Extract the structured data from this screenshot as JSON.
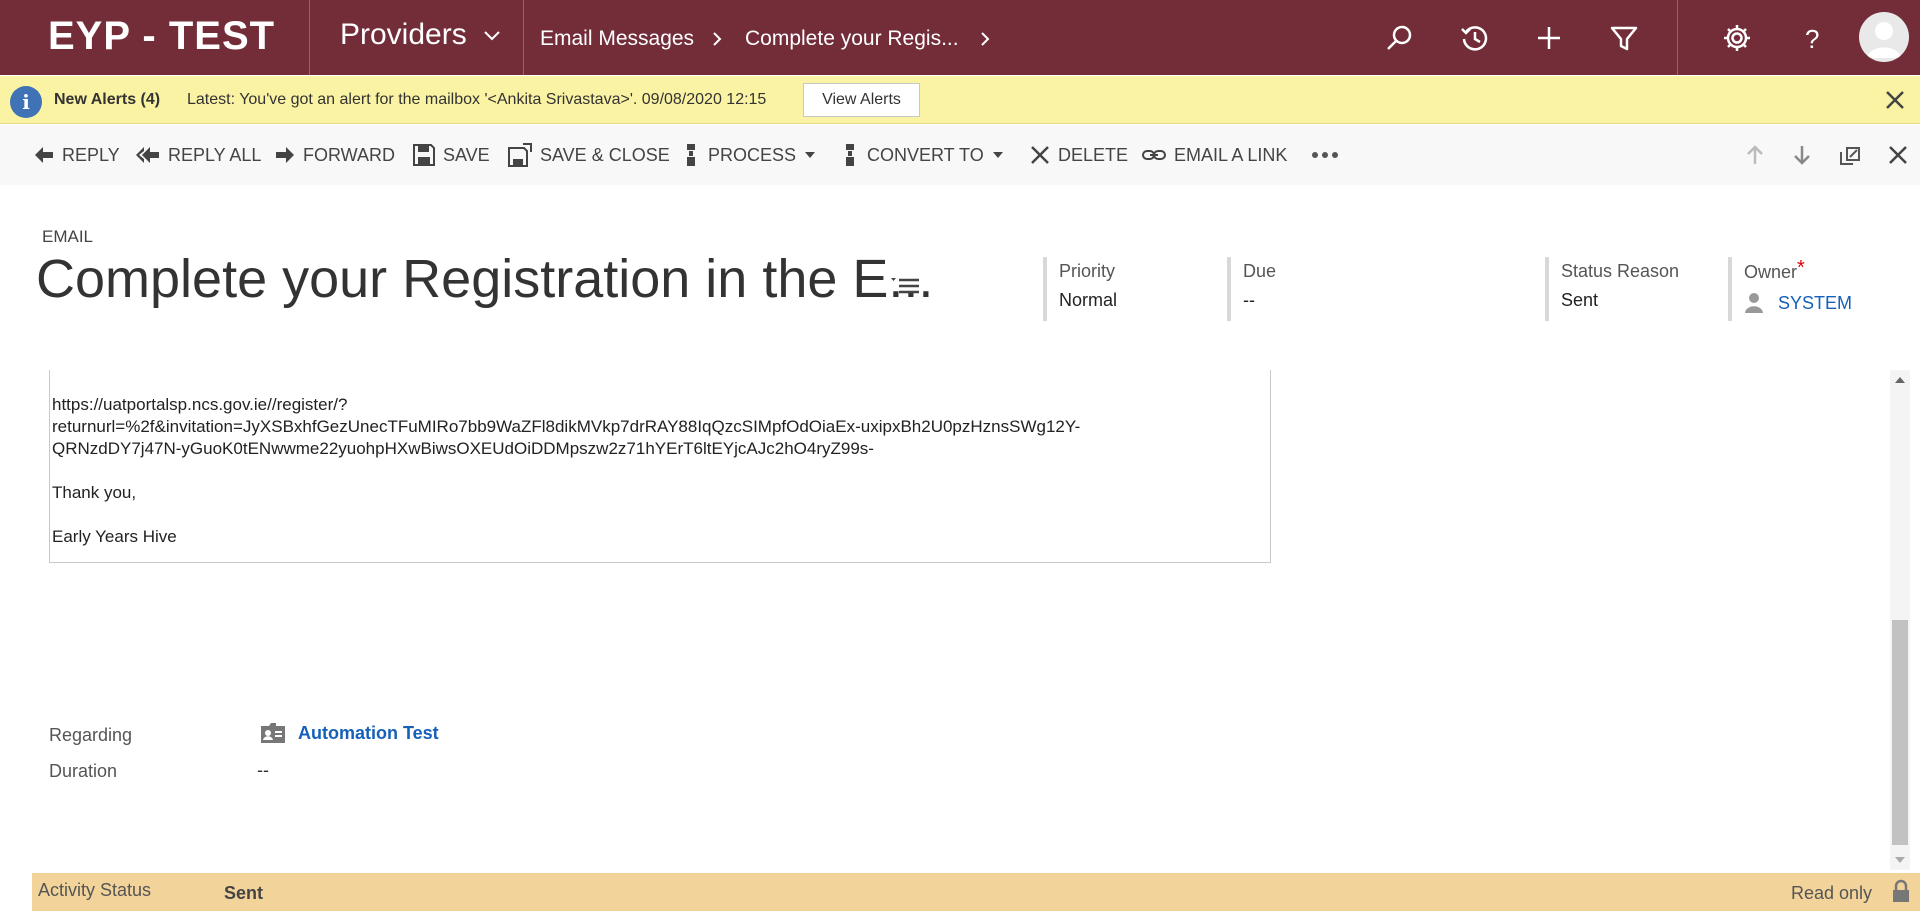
{
  "app": {
    "logo": "EYP - TEST",
    "area": "Providers",
    "breadcrumb": [
      "Email Messages",
      "Complete your Regis..."
    ]
  },
  "alert": {
    "title": "New Alerts (4)",
    "message": "Latest: You've got an alert for the mailbox '<Ankita Srivastava>'. 09/08/2020 12:15",
    "button": "View Alerts"
  },
  "commands": {
    "reply": "REPLY",
    "reply_all": "REPLY ALL",
    "forward": "FORWARD",
    "save": "SAVE",
    "save_close": "SAVE & CLOSE",
    "process": "PROCESS",
    "convert_to": "CONVERT TO",
    "delete": "DELETE",
    "email_link": "EMAIL A LINK"
  },
  "header": {
    "entity": "EMAIL",
    "title": "Complete your Registration in the E...",
    "fields": {
      "priority": {
        "label": "Priority",
        "value": "Normal"
      },
      "due": {
        "label": "Due",
        "value": "--"
      },
      "status_reason": {
        "label": "Status Reason",
        "value": "Sent"
      },
      "owner": {
        "label": "Owner",
        "required_mark": "*",
        "value": "SYSTEM"
      }
    }
  },
  "email_body": {
    "link_lines": [
      "https://uatportalsp.ncs.gov.ie//register/?",
      "returnurl=%2f&invitation=JyXSBxhfGezUnecTFuMIRo7bb9WaZFl8dikMVkp7drRAY88IqQzcSIMpfOdOiaEx-uxipxBh2U0pzHznsSWg12Y-",
      "QRNzdDY7j47N-yGuoK0tENwwme22yuohpHXwBiwsOXEUdOiDDMpszw2z71hYErT6ltEYjcAJc2hO4ryZ99s-"
    ],
    "thanks": "Thank you,",
    "signature": "Early Years Hive"
  },
  "details": {
    "regarding": {
      "label": "Regarding",
      "value": "Automation Test"
    },
    "duration": {
      "label": "Duration",
      "value": "--"
    }
  },
  "footer": {
    "label": "Activity Status",
    "value": "Sent",
    "readonly": "Read only"
  },
  "colors": {
    "topbar": "#722d39",
    "alert_bg": "#fbf3a4",
    "footer_bg": "#f2d49b",
    "link": "#1560b8"
  }
}
